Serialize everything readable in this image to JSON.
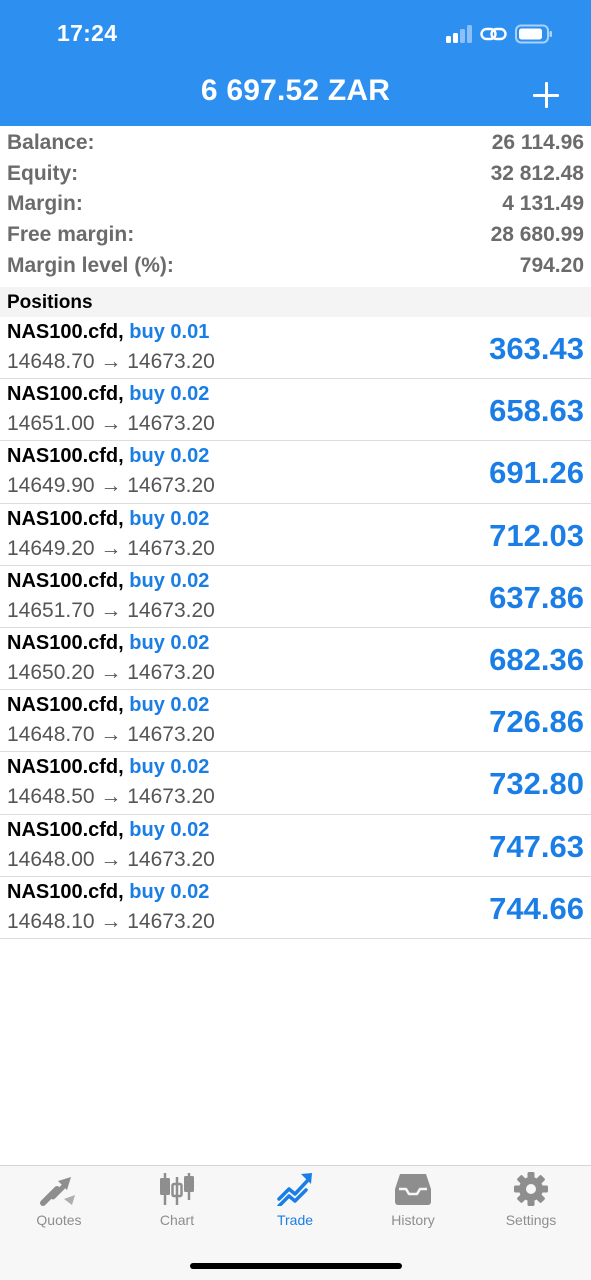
{
  "status_bar": {
    "time": "17:24",
    "icons": [
      "cellular-signal-icon",
      "link-icon",
      "battery-icon"
    ]
  },
  "header": {
    "title": "6 697.52 ZAR",
    "add_icon": "plus-icon"
  },
  "account": [
    {
      "label": "Balance:",
      "value": "26 114.96"
    },
    {
      "label": "Equity:",
      "value": "32 812.48"
    },
    {
      "label": "Margin:",
      "value": "4 131.49"
    },
    {
      "label": "Free margin:",
      "value": "28 680.99"
    },
    {
      "label": "Margin level (%):",
      "value": "794.20"
    }
  ],
  "positions_title": "Positions",
  "positions": [
    {
      "symbol": "NAS100.cfd,",
      "side": "buy 0.01",
      "prices": "14648.70 → 14673.20",
      "profit": "363.43"
    },
    {
      "symbol": "NAS100.cfd,",
      "side": "buy 0.02",
      "prices": "14651.00 → 14673.20",
      "profit": "658.63"
    },
    {
      "symbol": "NAS100.cfd,",
      "side": "buy 0.02",
      "prices": "14649.90 → 14673.20",
      "profit": "691.26"
    },
    {
      "symbol": "NAS100.cfd,",
      "side": "buy 0.02",
      "prices": "14649.20 → 14673.20",
      "profit": "712.03"
    },
    {
      "symbol": "NAS100.cfd,",
      "side": "buy 0.02",
      "prices": "14651.70 → 14673.20",
      "profit": "637.86"
    },
    {
      "symbol": "NAS100.cfd,",
      "side": "buy 0.02",
      "prices": "14650.20 → 14673.20",
      "profit": "682.36"
    },
    {
      "symbol": "NAS100.cfd,",
      "side": "buy 0.02",
      "prices": "14648.70 → 14673.20",
      "profit": "726.86"
    },
    {
      "symbol": "NAS100.cfd,",
      "side": "buy 0.02",
      "prices": "14648.50 → 14673.20",
      "profit": "732.80"
    },
    {
      "symbol": "NAS100.cfd,",
      "side": "buy 0.02",
      "prices": "14648.00 → 14673.20",
      "profit": "747.63"
    },
    {
      "symbol": "NAS100.cfd,",
      "side": "buy 0.02",
      "prices": "14648.10 → 14673.20",
      "profit": "744.66"
    }
  ],
  "tabs": [
    {
      "label": "Quotes",
      "icon": "quotes-arrows-icon",
      "active": false
    },
    {
      "label": "Chart",
      "icon": "candlestick-chart-icon",
      "active": false
    },
    {
      "label": "Trade",
      "icon": "trade-trend-icon",
      "active": true
    },
    {
      "label": "History",
      "icon": "history-inbox-icon",
      "active": false
    },
    {
      "label": "Settings",
      "icon": "gear-icon",
      "active": false
    }
  ],
  "colors": {
    "header_bg": "#2d8ff0",
    "accent": "#1a7ee6",
    "inactive_tab": "#8e8e8e",
    "summary_text": "#6b6b6b"
  }
}
